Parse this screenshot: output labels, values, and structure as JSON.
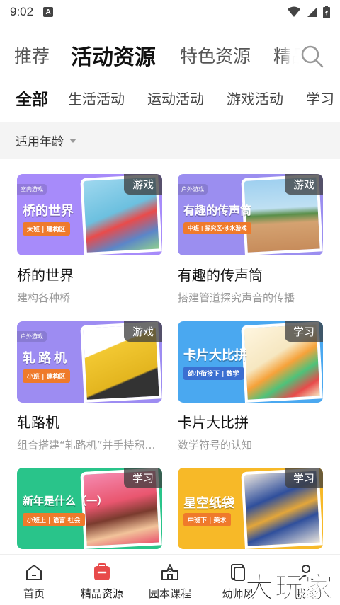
{
  "status": {
    "time": "9:02",
    "notif": "A"
  },
  "top_tabs": [
    "推荐",
    "活动资源",
    "特色资源",
    "精品"
  ],
  "sub_tabs": [
    "全部",
    "生活活动",
    "运动活动",
    "游戏活动",
    "学习"
  ],
  "filter": {
    "label": "适用年龄"
  },
  "cards": [
    {
      "title": "桥的世界",
      "desc": "建构各种桥",
      "type": "游戏",
      "corner": "室内游戏",
      "poster_title": "桥的世界",
      "poster_tag": "大班 | 建构区",
      "bg": "#a78bfa",
      "photo": "#7ec8e3"
    },
    {
      "title": "有趣的传声筒",
      "desc": "搭建管道探究声音的传播",
      "type": "游戏",
      "corner": "户外游戏",
      "poster_title": "有趣的传声筒",
      "poster_tag": "中班 | 探究区·沙水游戏",
      "bg": "#9b8ef0",
      "photo": "#c9a27a"
    },
    {
      "title": "轧路机",
      "desc": "组合搭建“轧路机”并手持积…",
      "type": "游戏",
      "corner": "户外游戏",
      "poster_title": "轧路机",
      "poster_tag": "小班 | 建构区",
      "bg": "#9d8cf2",
      "photo": "#f4d03f"
    },
    {
      "title": "卡片大比拼",
      "desc": "数学符号的认知",
      "type": "学习",
      "corner": "",
      "poster_title": "卡片大比拼",
      "poster_tag": "幼小衔接下 | 数学",
      "bg": "#4aa8f0",
      "photo": "#f6e7c1"
    },
    {
      "title": "",
      "desc": "",
      "type": "学习",
      "corner": "",
      "poster_title": "新年是什么（一）",
      "poster_tag": "小班上 | 语言 社会",
      "bg": "#29c48a",
      "photo": "#f58ab0"
    },
    {
      "title": "",
      "desc": "",
      "type": "学习",
      "corner": "",
      "poster_title": "星空纸袋",
      "poster_tag": "中班下 | 美术",
      "bg": "#f7b928",
      "photo": "#e9e4dc"
    }
  ],
  "bottom_nav": [
    "首页",
    "精品资源",
    "园本课程",
    "幼师风",
    "我的"
  ],
  "watermark": "大玩家",
  "colors": {
    "accent": "#e84a4a",
    "filter_bg": "#f4f4f4"
  }
}
